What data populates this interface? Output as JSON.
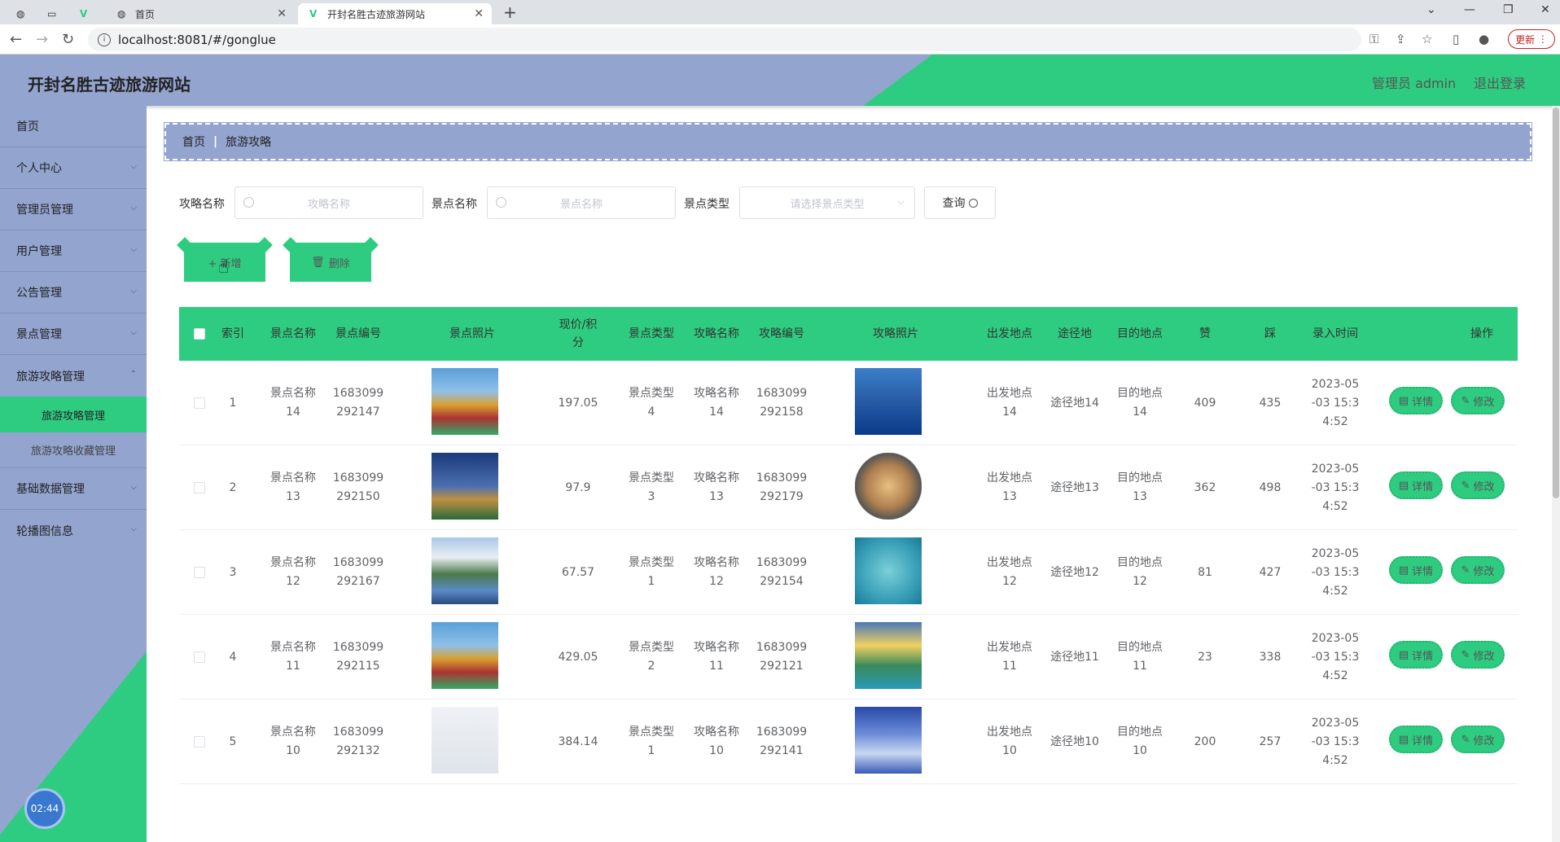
{
  "browser": {
    "tabs": [
      {
        "label": "首页"
      },
      {
        "label": "开封名胜古迹旅游网站"
      }
    ],
    "url": "localhost:8081/#/gonglue",
    "update_label": "更新"
  },
  "header": {
    "title": "开封名胜古迹旅游网站",
    "user": "管理员 admin",
    "logout": "退出登录"
  },
  "sidebar": {
    "items": [
      "首页",
      "个人中心",
      "管理员管理",
      "用户管理",
      "公告管理",
      "景点管理",
      "旅游攻略管理"
    ],
    "sub_items": [
      "旅游攻略管理",
      "旅游攻略收藏管理"
    ],
    "items_after": [
      "基础数据管理",
      "轮播图信息"
    ],
    "clock": "02:44"
  },
  "breadcrumb": {
    "home": "首页",
    "current": "旅游攻略"
  },
  "search": {
    "label1": "攻略名称",
    "placeholder1": "攻略名称",
    "label2": "景点名称",
    "placeholder2": "景点名称",
    "label3": "景点类型",
    "placeholder3": "请选择景点类型",
    "query": "查询"
  },
  "actions": {
    "add": "+ 新增",
    "delete": "删除"
  },
  "table": {
    "headers": [
      "索引",
      "景点名称",
      "景点编号",
      "景点照片",
      "现价/积\n分",
      "景点类型",
      "攻略名称",
      "攻略编号",
      "攻略照片",
      "出发地点",
      "途径地",
      "目的地点",
      "赞",
      "踩",
      "录入时间",
      "操作"
    ],
    "rows": [
      {
        "idx": "1",
        "name": "景点名称\n14",
        "no": "1683099\n292147",
        "price": "197.05",
        "type": "景点类型\n4",
        "gname": "攻略名称\n14",
        "gno": "1683099\n292158",
        "from": "出发地点\n14",
        "via": "途径地14",
        "to": "目的地点\n14",
        "zan": "409",
        "cai": "435",
        "time": "2023-05\n-03 15:3\n4:52"
      },
      {
        "idx": "2",
        "name": "景点名称\n13",
        "no": "1683099\n292150",
        "price": "97.9",
        "type": "景点类型\n3",
        "gname": "攻略名称\n13",
        "gno": "1683099\n292179",
        "from": "出发地点\n13",
        "via": "途径地13",
        "to": "目的地点\n13",
        "zan": "362",
        "cai": "498",
        "time": "2023-05\n-03 15:3\n4:52"
      },
      {
        "idx": "3",
        "name": "景点名称\n12",
        "no": "1683099\n292167",
        "price": "67.57",
        "type": "景点类型\n1",
        "gname": "攻略名称\n12",
        "gno": "1683099\n292154",
        "from": "出发地点\n12",
        "via": "途径地12",
        "to": "目的地点\n12",
        "zan": "81",
        "cai": "427",
        "time": "2023-05\n-03 15:3\n4:52"
      },
      {
        "idx": "4",
        "name": "景点名称\n11",
        "no": "1683099\n292115",
        "price": "429.05",
        "type": "景点类型\n2",
        "gname": "攻略名称\n11",
        "gno": "1683099\n292121",
        "from": "出发地点\n11",
        "via": "途径地11",
        "to": "目的地点\n11",
        "zan": "23",
        "cai": "338",
        "time": "2023-05\n-03 15:3\n4:52"
      },
      {
        "idx": "5",
        "name": "景点名称\n10",
        "no": "1683099\n292132",
        "price": "384.14",
        "type": "景点类型\n1",
        "gname": "攻略名称\n10",
        "gno": "1683099\n292141",
        "from": "出发地点\n10",
        "via": "途径地10",
        "to": "目的地点\n10",
        "zan": "200",
        "cai": "257",
        "time": "2023-05\n-03 15:3\n4:52"
      }
    ],
    "detail_label": "详情",
    "edit_label": "修改"
  }
}
